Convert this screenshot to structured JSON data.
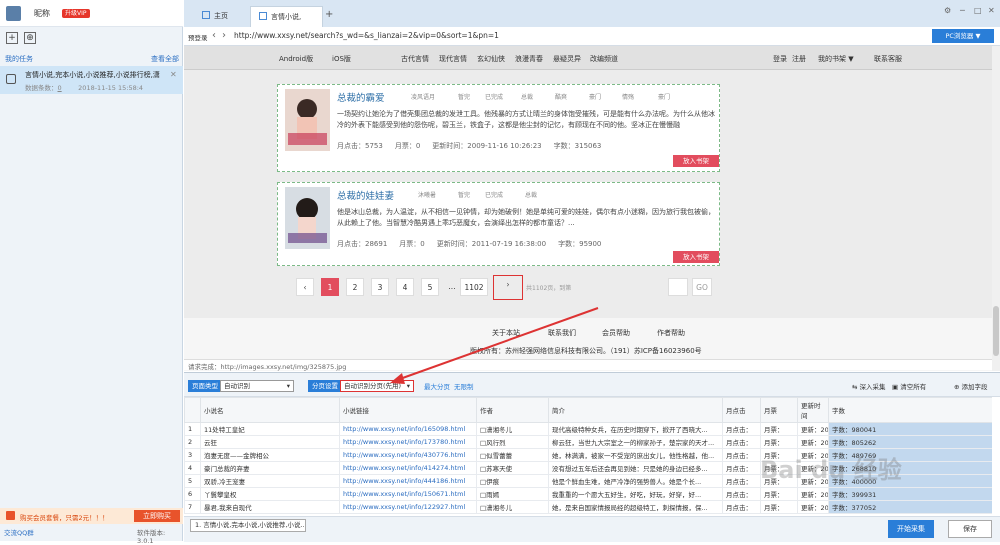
{
  "left_panel": {
    "nickname": "昵称",
    "vip_badge": "升级VIP",
    "my_tasks": "我的任务",
    "view_all": "查看全部",
    "task": {
      "title": "言情小说,完本小说,小说推荐,小说排行榜,潇",
      "count_label": "数据条数：",
      "count": "0",
      "time": "2018-11-15 15:58:4"
    },
    "promo_text": "购买会员套餐，只需2元！！！",
    "promo_button": "立即购买",
    "qq": "交流QQ群",
    "version": "软件版本: 3.0.1"
  },
  "browser": {
    "tabs": [
      {
        "label": "主页"
      },
      {
        "label": "言情小说,完..."
      }
    ],
    "plus": "+",
    "login_label": "预登录",
    "url": "http://www.xxsy.net/search?s_wd=&s_lianzai=2&vip=0&sort=1&pn=1",
    "pc_button": "PC浏览器",
    "status": "请求完成：http://images.xxsy.net/img/325875.jpg"
  },
  "site": {
    "nav": [
      "Android版",
      "iOS版",
      "古代言情",
      "现代言情",
      "玄幻仙侠",
      "浪漫青春",
      "悬疑灵异",
      "改编频道"
    ],
    "nav_right": [
      "登录",
      "注册",
      "我的书架 ▼",
      "联系客服"
    ],
    "books": [
      {
        "title": "总裁的霸爱",
        "author": "凌风语月",
        "status": "暂完",
        "finish": "已完成",
        "type": "总裁",
        "tags": [
          "酷爽",
          "豪门",
          "情殇",
          "豪门"
        ],
        "desc": "一场契约让她沦为了借壳集团总裁的发泄工具。他残暴的方式让晴兰的身体饱受摧残，可是能有什么办法呢。为什么从他冰冷的外表下能感受到他的怨伤呢，碧玉兰，铁盒子，这都是他尘封的记忆，有顾现在不同的他。坚冰正在慢慢融",
        "clicks": "月点击：5753",
        "tickets": "月票：0",
        "updated": "更新时间：2009-11-16 10:26:23",
        "words": "字数：315063",
        "button": "放入书架"
      },
      {
        "title": "总裁的娃娃妻",
        "author": "沐曦暑",
        "status": "暂完",
        "finish": "已完成",
        "type": "总裁",
        "tags": [],
        "desc": "他是冰山总裁，为人温淀，从不相信一见钟情，却为她破例！她是单纯可爱的娃娃，偶尔有点小迷糊，因为旅行我包被偷，从此赖上了他。当智慧冷酷男遇上乖巧恶魔女，会演绎出怎样的都市童话？...",
        "clicks": "月点击：28691",
        "tickets": "月票：0",
        "updated": "更新时间：2011-07-19 16:38:00",
        "words": "字数：95900",
        "button": "放入书架"
      }
    ],
    "pager": {
      "pages": [
        "1",
        "2",
        "3",
        "4",
        "5",
        "...",
        "1102"
      ],
      "current": "1",
      "total": "共1102页，到第",
      "go": "GO"
    },
    "footer_links": [
      "关于本站",
      "联系我们",
      "会员帮助",
      "作者帮助"
    ],
    "copyright": "版权所有：苏州轻强网络信息科技有限公司。（191）苏ICP备16023960号"
  },
  "bottom": {
    "page_type_label": "页面类型",
    "page_type_value": "自动识别",
    "paging_label": "分页设置",
    "paging_value": "自动识别分页(先用)",
    "max_pages": "最大分页",
    "unlimited": "无限制",
    "actions": [
      "深入采集",
      "清空所有",
      "添加字段"
    ],
    "columns": [
      "",
      "小说名",
      "小说链接",
      "作者",
      "简介",
      "月点击",
      "月票",
      "更新时间",
      "字数"
    ],
    "rows": [
      [
        "1",
        "11处特工皇妃",
        "http://www.xxsy.net/info/165098.html",
        "□潇湘冬儿",
        "现代高级特种女兵，在历史时期穿下，掀开了西晓大...",
        "月点击：",
        "月票：",
        "更新：20",
        "字数：980041"
      ],
      [
        "2",
        "云狂",
        "http://www.xxsy.net/info/173780.html",
        "□风行烈",
        "柳云狂，当世九大宗室之一的柳家孙子，楚宗家的天才...",
        "月点击：",
        "月票：",
        "更新：20",
        "字数：805262"
      ],
      [
        "3",
        "泡妻无度——金牌相公",
        "http://www.xxsy.net/info/430776.html",
        "□似雪蕾蕾",
        "她，林满满，被家一不受宠的庶出女儿，他性格越，他...",
        "月点击：",
        "月票：",
        "更新：20",
        "字数：489769"
      ],
      [
        "4",
        "豪门总裁的弃妻",
        "http://www.xxsy.net/info/414274.html",
        "□苏寒天使",
        "没有想过五年后还会再见到她：只是她的身边已经多...",
        "月点击：",
        "月票：",
        "更新：20",
        "字数：268810"
      ],
      [
        "5",
        "双骄,冷王宠妻",
        "http://www.xxsy.net/info/444186.html",
        "□伊痕",
        "他是个鲜血生难，她严冷净的强势兽人。她是个长...",
        "月点击：",
        "月票：",
        "更新：20",
        "字数：400000"
      ],
      [
        "6",
        "丫鬟攀皇权",
        "http://www.xxsy.net/info/150671.html",
        "□雨嫣",
        "我重重的一个愿大五好生，好吃，好玩，好穿，好...",
        "月点击：",
        "月票：",
        "更新：20",
        "字数：399931"
      ],
      [
        "7",
        "暴君,我来自现代",
        "http://www.xxsy.net/info/122927.html",
        "□潇湘冬儿",
        "她，是来自国家情报局经的超级特工，刺探情报，保...",
        "月点击：",
        "月票：",
        "更新：20",
        "字数：377052"
      ]
    ],
    "task_tab": "1. 言情小说,完本小说,小说推荐,小说...",
    "start_button": "开始采集",
    "save_button": "保存"
  },
  "watermark": "Bai du 经验"
}
